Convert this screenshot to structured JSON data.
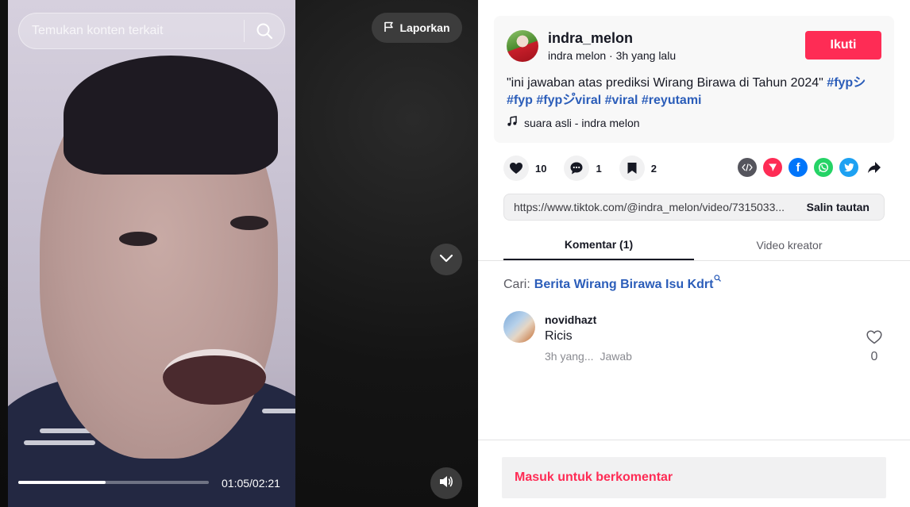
{
  "video": {
    "search_placeholder": "Temukan konten terkait",
    "report_label": "Laporkan",
    "time": "01:05/02:21",
    "progress": 0.46
  },
  "post": {
    "username": "indra_melon",
    "display_name": "indra melon",
    "separator": "·",
    "posted_ago": "3h yang lalu",
    "follow_label": "Ikuti",
    "caption_text": "\"ini jawaban atas prediksi Wirang Birawa di Tahun 2024\"",
    "hashtags": [
      "#fypシ",
      "#fyp",
      "#fypシ゚viral",
      "#viral",
      "#reyutami"
    ],
    "sound": "suara asli - indra melon"
  },
  "stats": {
    "likes": "10",
    "comments": "1",
    "saves": "2"
  },
  "share": {
    "icons": [
      "embed-icon",
      "send-icon",
      "facebook-icon",
      "whatsapp-icon",
      "twitter-icon",
      "share-arrow-icon"
    ],
    "colors": {
      "embed": "#55555d",
      "send": "#fe2c55",
      "facebook": "#0075fa",
      "whatsapp": "#25d366",
      "twitter": "#1da1f2"
    }
  },
  "link": {
    "url": "https://www.tiktok.com/@indra_melon/video/7315033...",
    "copy_label": "Salin tautan"
  },
  "tabs": {
    "comments": "Komentar (1)",
    "creator_videos": "Video kreator"
  },
  "search_suggestion": {
    "label": "Cari:",
    "term": "Berita Wirang Birawa Isu Kdrt"
  },
  "comments": [
    {
      "user": "novidhazt",
      "text": "Ricis",
      "time": "3h yang...",
      "reply_label": "Jawab",
      "likes": "0"
    }
  ],
  "login_prompt": "Masuk untuk berkomentar",
  "colors": {
    "accent": "#fe2c55",
    "link": "#2b5db9"
  }
}
